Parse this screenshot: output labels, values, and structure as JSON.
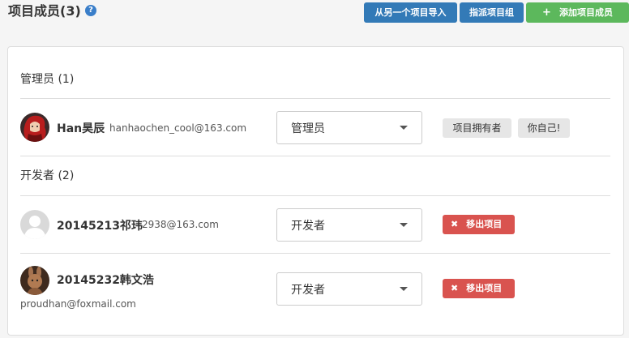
{
  "header": {
    "title": "项目成员(3)",
    "help_icon_glyph": "?",
    "import_button": "从另一个项目导入",
    "assign_button": "指派项目组",
    "add_button": "添加项目成员",
    "add_icon_glyph": "+"
  },
  "sections": {
    "admins_label": "管理员 (1)",
    "developers_label": "开发者 (2)"
  },
  "members": [
    {
      "name": "Han昊辰",
      "email": "hanhaochen_cool@163.com",
      "role": "管理员",
      "tags": [
        "项目拥有者",
        "你自己!"
      ],
      "avatar": "red-haired-character-avatar"
    },
    {
      "name": "20145213祁玮",
      "email": "2938@163.com",
      "role": "开发者",
      "remove_label": "移出项目",
      "avatar": "default-user-avatar"
    },
    {
      "name": "20145232韩文浩",
      "email": "proudhan@foxmail.com",
      "role": "开发者",
      "remove_label": "移出项目",
      "avatar": "rabbit-avatar"
    }
  ],
  "colors": {
    "primary": "#337ab7",
    "success": "#5cb85c",
    "danger": "#d9534f",
    "tag_bg": "#e6e6e6"
  },
  "remove_icon_glyph": "✖"
}
